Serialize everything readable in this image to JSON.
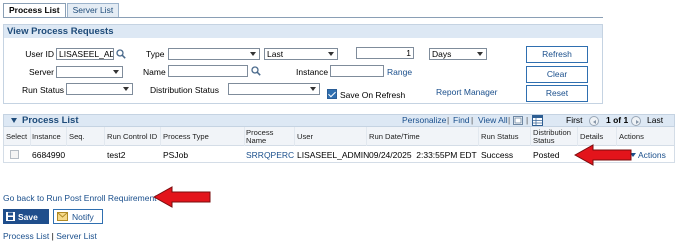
{
  "tabs": [
    {
      "label": "Process List",
      "active": true
    },
    {
      "label": "Server List",
      "active": false
    }
  ],
  "criteria": {
    "title": "View Process Requests",
    "user_id_label": "User ID",
    "user_id_value": "LISASEEL_ADI",
    "type_label": "Type",
    "type_value": "",
    "last_value": "Last",
    "last_count": "1",
    "days_value": "Days",
    "refresh_label": "Refresh",
    "server_label": "Server",
    "server_value": "",
    "name_label": "Name",
    "name_value": "",
    "instance_label": "Instance",
    "instance_value": "",
    "range_label": "Range",
    "clear_label": "Clear",
    "run_status_label": "Run Status",
    "run_status_value": "",
    "dist_status_label": "Distribution Status",
    "dist_status_value": "",
    "save_on_refresh_label": "Save On Refresh",
    "save_on_refresh_checked": true,
    "report_manager_label": "Report Manager",
    "reset_label": "Reset"
  },
  "grid": {
    "title": "Process List",
    "personalize": "Personalize",
    "find": "Find",
    "view_all": "View All",
    "sep": "|",
    "first": "First",
    "range": "1 of 1",
    "last": "Last",
    "columns": [
      "Select",
      "Instance",
      "Seq.",
      "Run Control ID",
      "Process Type",
      "Process Name",
      "User",
      "Run Date/Time",
      "Run Status",
      "Distribution Status",
      "Details",
      "Actions"
    ],
    "rows": [
      {
        "instance": "6684990",
        "seq": "",
        "run_control_id": "test2",
        "process_type": "PSJob",
        "process_name": "SRRQPERC",
        "user": "LISASEEL_ADMIN",
        "run_datetime": "09/24/2025  2:33:55PM EDT",
        "run_status": "Success",
        "distribution_status": "Posted",
        "details": "",
        "actions": "Actions"
      }
    ]
  },
  "go_back_label": "Go back to Run Post Enroll Requirement",
  "save_label": "Save",
  "notify_label": "Notify",
  "footer_links": {
    "process_list": "Process List",
    "sep": "|",
    "server_list": "Server List"
  },
  "colors": {
    "link": "#1a4f8c",
    "header_bg": "#dde8f4",
    "save_bg": "#1f4e8c",
    "arrow": "#e3141b"
  },
  "icons": [
    "search-icon",
    "chevron-down-icon",
    "checkbox-checked-icon",
    "collapse-triangle-icon",
    "grid-icon",
    "nav-first-icon",
    "nav-next-icon",
    "save-disk-icon",
    "notify-mail-icon",
    "red-arrow-icon"
  ]
}
